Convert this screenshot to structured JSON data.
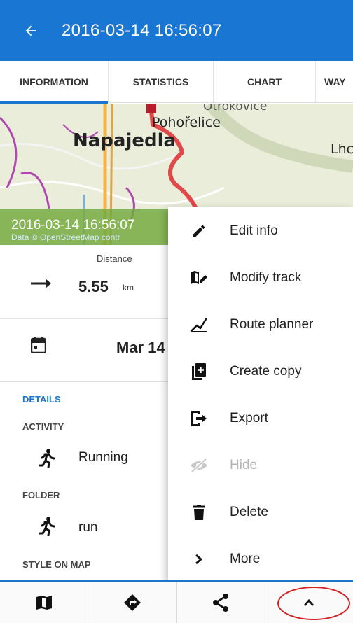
{
  "app_bar": {
    "title": "2016-03-14 16:56:07"
  },
  "tabs": [
    {
      "label": "INFORMATION"
    },
    {
      "label": "STATISTICS"
    },
    {
      "label": "CHART"
    },
    {
      "label": "WAY"
    }
  ],
  "map": {
    "labels": [
      "Napajedla",
      "Pohořelice",
      "Lhc",
      "Otrokovice"
    ],
    "track_date": "2016-03-14 16:56:07",
    "attribution": "Data © OpenStreetMap contr"
  },
  "summary": {
    "distance_label": "Distance",
    "distance_value": "5.55",
    "distance_unit": "km",
    "date": "Mar 14"
  },
  "details": {
    "section_title": "DETAILS",
    "activity_label": "ACTIVITY",
    "activity_value": "Running",
    "folder_label": "FOLDER",
    "folder_value": "run",
    "style_label": "STYLE ON MAP"
  },
  "menu": {
    "items": [
      {
        "label": "Edit info",
        "icon": "pencil-icon"
      },
      {
        "label": "Modify track",
        "icon": "map-edit-icon"
      },
      {
        "label": "Route planner",
        "icon": "route-planner-icon"
      },
      {
        "label": "Create copy",
        "icon": "copy-icon"
      },
      {
        "label": "Export",
        "icon": "export-icon"
      },
      {
        "label": "Hide",
        "icon": "eye-off-icon",
        "disabled": true
      },
      {
        "label": "Delete",
        "icon": "trash-icon"
      },
      {
        "label": "More",
        "icon": "chevron-right-icon"
      }
    ]
  },
  "bottom_bar": {
    "buttons": [
      "map-icon",
      "navigate-icon",
      "share-icon",
      "chevron-up-icon"
    ]
  },
  "colors": {
    "primary": "#1976d2",
    "map_band": "#76aa40",
    "track": "#e0484a",
    "highlight": "#d61f1f"
  }
}
